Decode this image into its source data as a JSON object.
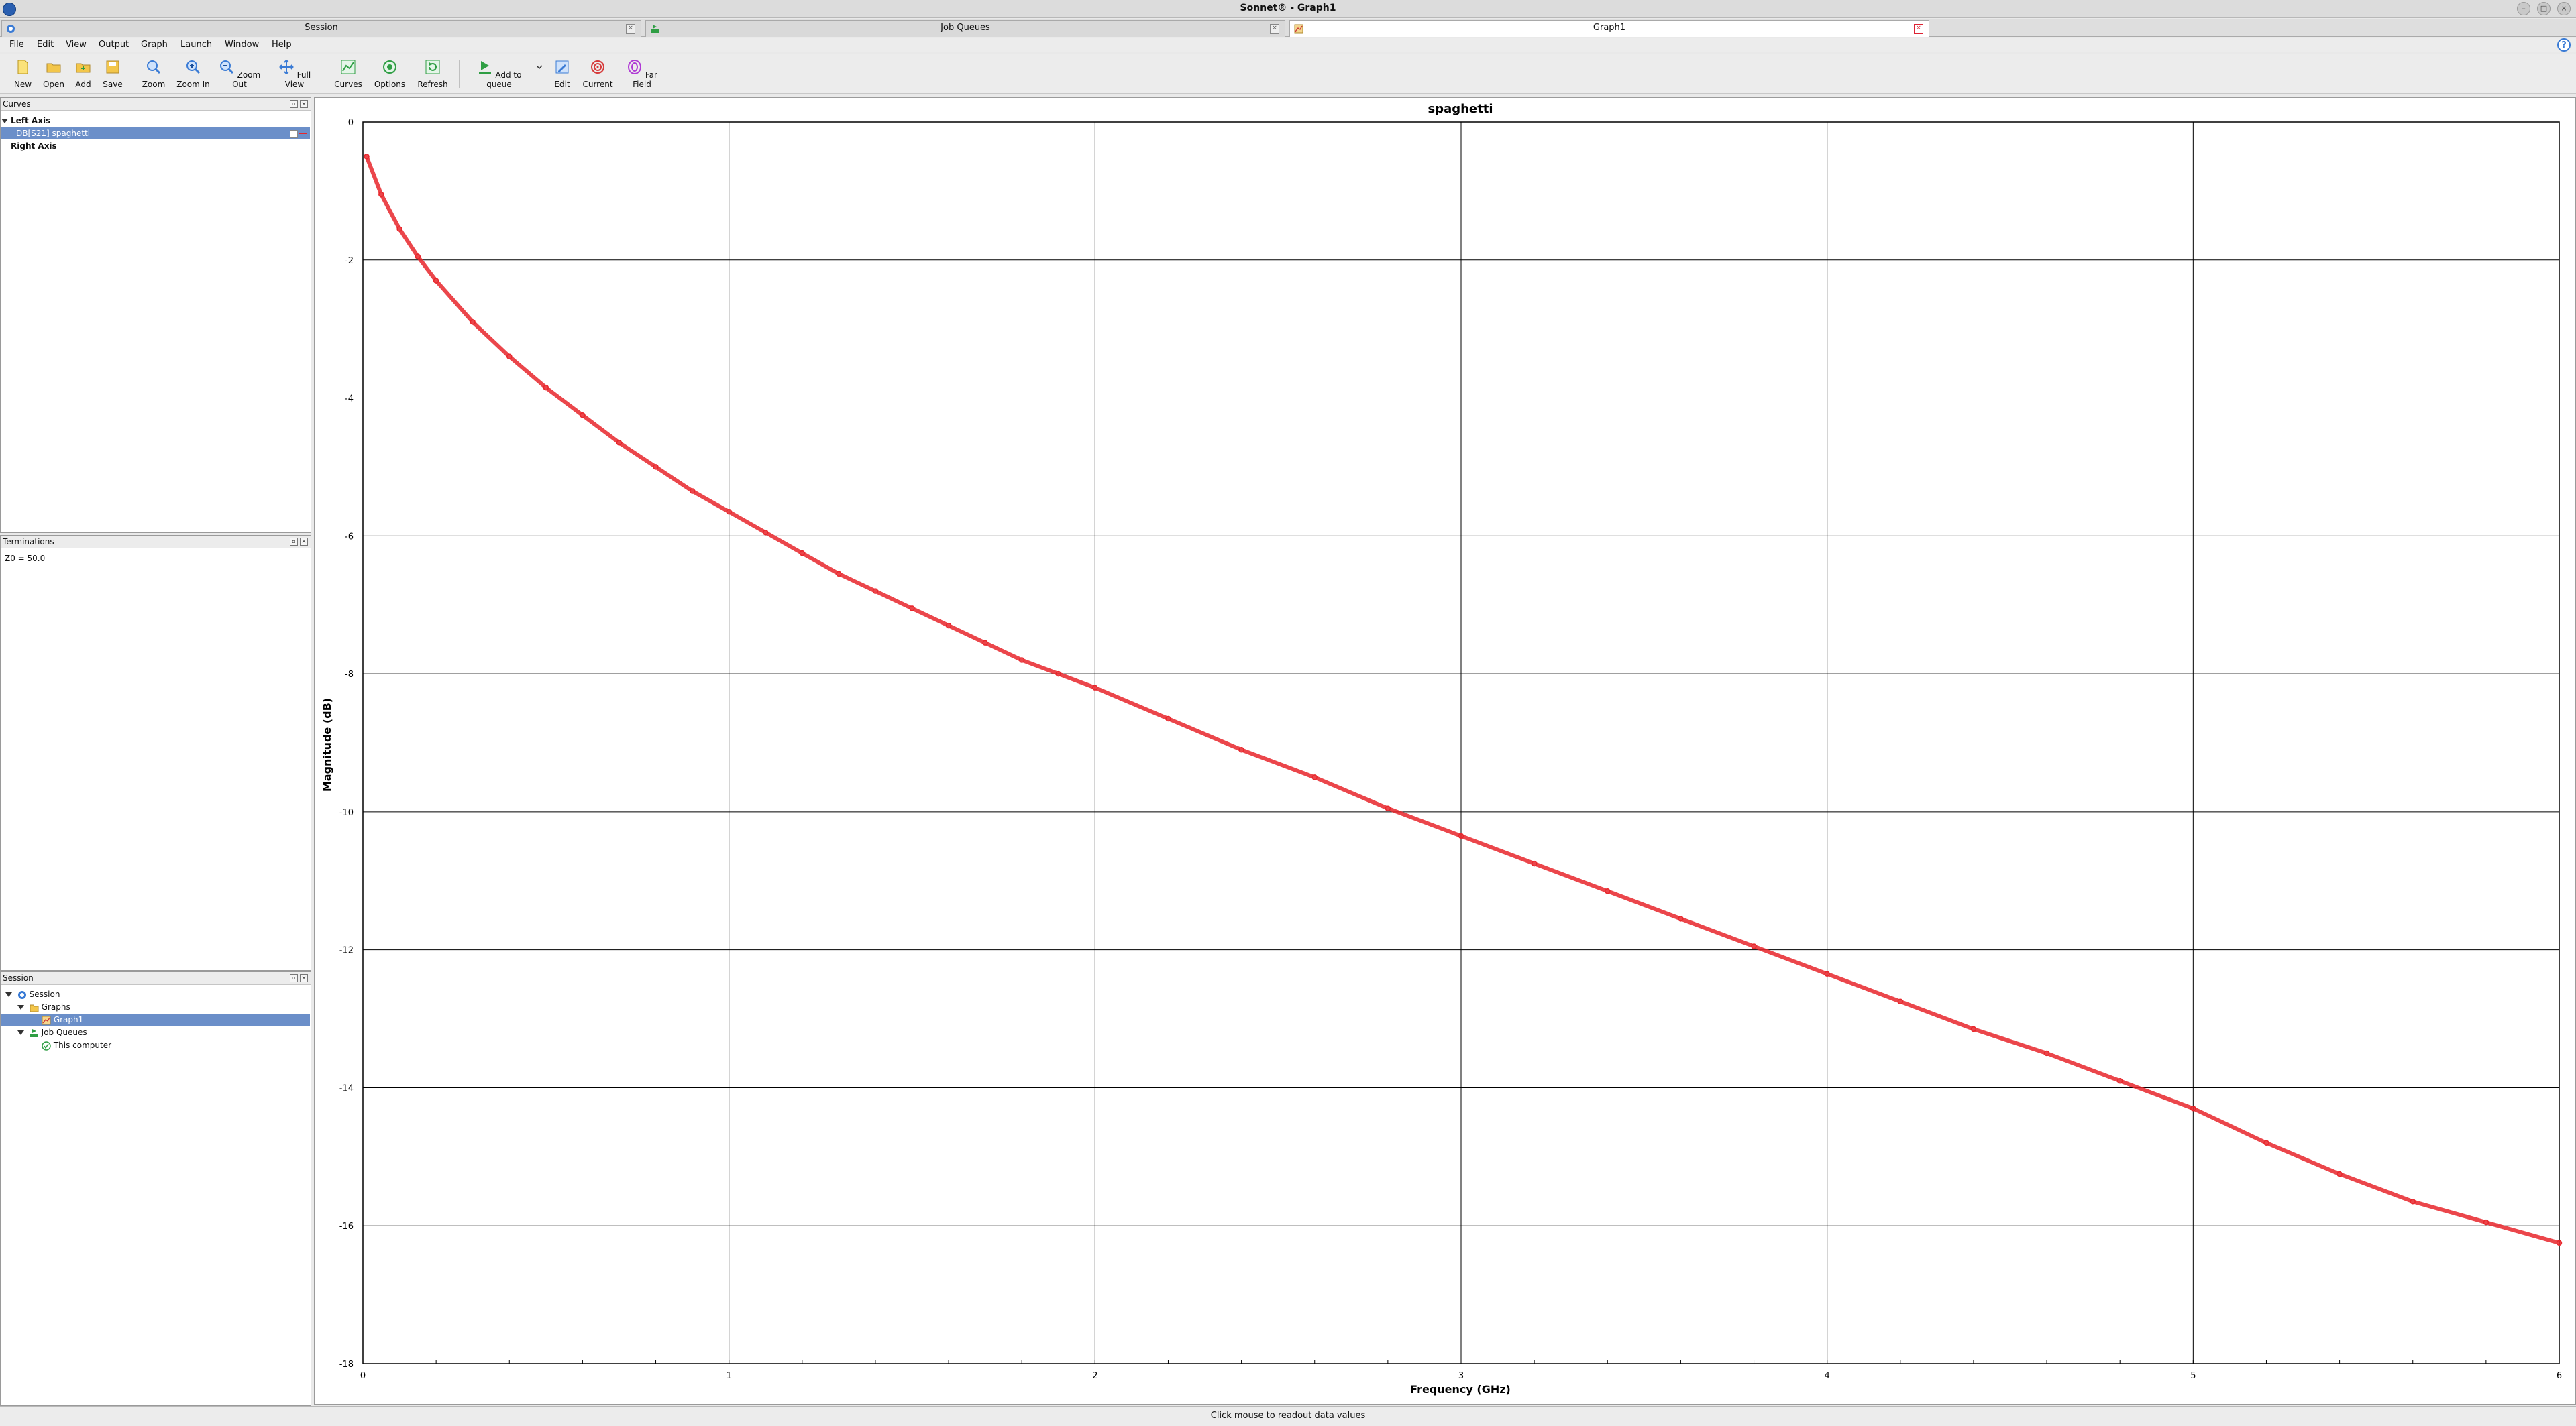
{
  "window": {
    "title": "Sonnet® - Graph1"
  },
  "tabs": [
    {
      "label": "Session",
      "active": false
    },
    {
      "label": "Job Queues",
      "active": false
    },
    {
      "label": "Graph1",
      "active": true
    }
  ],
  "menu": [
    "File",
    "Edit",
    "View",
    "Output",
    "Graph",
    "Launch",
    "Window",
    "Help"
  ],
  "toolbar": [
    {
      "label": "New",
      "icon": "new-file-icon"
    },
    {
      "label": "Open",
      "icon": "folder-open-icon"
    },
    {
      "label": "Add",
      "icon": "add-folder-icon"
    },
    {
      "label": "Save",
      "icon": "save-icon"
    },
    {
      "label": "Zoom",
      "icon": "magnifier-icon"
    },
    {
      "label": "Zoom In",
      "icon": "zoom-in-icon"
    },
    {
      "label": "Zoom Out",
      "icon": "zoom-out-icon"
    },
    {
      "label": "Full View",
      "icon": "full-view-icon"
    },
    {
      "label": "Curves",
      "icon": "curves-icon"
    },
    {
      "label": "Options",
      "icon": "options-icon"
    },
    {
      "label": "Refresh",
      "icon": "refresh-icon"
    },
    {
      "label": "Add to queue",
      "icon": "queue-icon"
    },
    {
      "label": "Edit",
      "icon": "edit-icon"
    },
    {
      "label": "Current",
      "icon": "current-icon"
    },
    {
      "label": "Far Field",
      "icon": "far-field-icon"
    }
  ],
  "curves_panel": {
    "title": "Curves",
    "left_axis": "Left Axis",
    "curve_item": "DB[S21] spaghetti",
    "right_axis": "Right Axis"
  },
  "terminations_panel": {
    "title": "Terminations",
    "z0": "Z0 = 50.0"
  },
  "session_panel": {
    "title": "Session",
    "items": [
      "Session",
      "Graphs",
      "Graph1",
      "Job Queues",
      "This computer"
    ]
  },
  "status": "Click mouse to readout data values",
  "colors": {
    "curve": "#e8262b",
    "selection": "#6b8fc9",
    "accent": "#3a7bd5"
  },
  "chart_data": {
    "type": "line",
    "title": "spaghetti",
    "xlabel": "Frequency (GHz)",
    "ylabel": "Magnitude (dB)",
    "xlim": [
      0,
      6
    ],
    "ylim": [
      -18,
      0
    ],
    "xticks": [
      0,
      1,
      2,
      3,
      4,
      5,
      6
    ],
    "yticks": [
      0,
      -2,
      -4,
      -6,
      -8,
      -10,
      -12,
      -14,
      -16,
      -18
    ],
    "grid": true,
    "series": [
      {
        "name": "DB[S21] spaghetti",
        "x": [
          0.01,
          0.05,
          0.1,
          0.15,
          0.2,
          0.3,
          0.4,
          0.5,
          0.6,
          0.7,
          0.8,
          0.9,
          1.0,
          1.1,
          1.2,
          1.3,
          1.4,
          1.5,
          1.6,
          1.7,
          1.8,
          1.9,
          2.0,
          2.2,
          2.4,
          2.6,
          2.8,
          3.0,
          3.2,
          3.4,
          3.6,
          3.8,
          4.0,
          4.2,
          4.4,
          4.6,
          4.8,
          5.0,
          5.2,
          5.4,
          5.6,
          5.8,
          6.0
        ],
        "y": [
          -0.5,
          -1.05,
          -1.55,
          -1.95,
          -2.3,
          -2.9,
          -3.4,
          -3.85,
          -4.25,
          -4.65,
          -5.0,
          -5.35,
          -5.65,
          -5.95,
          -6.25,
          -6.55,
          -6.8,
          -7.05,
          -7.3,
          -7.55,
          -7.8,
          -8.0,
          -8.2,
          -8.65,
          -9.1,
          -9.5,
          -9.95,
          -10.35,
          -10.75,
          -11.15,
          -11.55,
          -11.95,
          -12.35,
          -12.75,
          -13.15,
          -13.5,
          -13.9,
          -14.3,
          -14.8,
          -15.25,
          -15.65,
          -15.95,
          -16.25
        ]
      }
    ]
  }
}
